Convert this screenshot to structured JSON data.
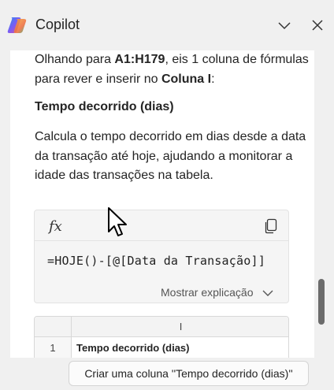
{
  "header": {
    "title": "Copilot",
    "logo_icon": "copilot-logo",
    "collapse_icon": "chevron-down-icon",
    "close_icon": "close-icon"
  },
  "message": {
    "intro_prefix": "Olhando para ",
    "intro_range": "A1:H179",
    "intro_middle": ", eis 1 coluna de fórmulas para rever e inserir no ",
    "intro_column": "Coluna I",
    "intro_suffix": ":",
    "section_title": "Tempo decorrido (dias)",
    "description": "Calcula o tempo decorrido em dias desde a data da transação até hoje, ajudando a monitorar a idade das transações na tabela."
  },
  "formula_card": {
    "fx_label": "fx",
    "copy_icon": "copy-icon",
    "formula": "=HOJE()-[@[Data da Transação]]",
    "explain_label": "Mostrar explicação"
  },
  "preview_table": {
    "column_header": "I",
    "row_number": "1",
    "cell_value": "Tempo decorrido (dias)"
  },
  "suggestion": {
    "label": "Criar uma coluna ''Tempo decorrido (dias)''"
  },
  "colors": {
    "background": "#f0f0f0",
    "panel": "#ffffff",
    "card": "#f5f5f5"
  }
}
